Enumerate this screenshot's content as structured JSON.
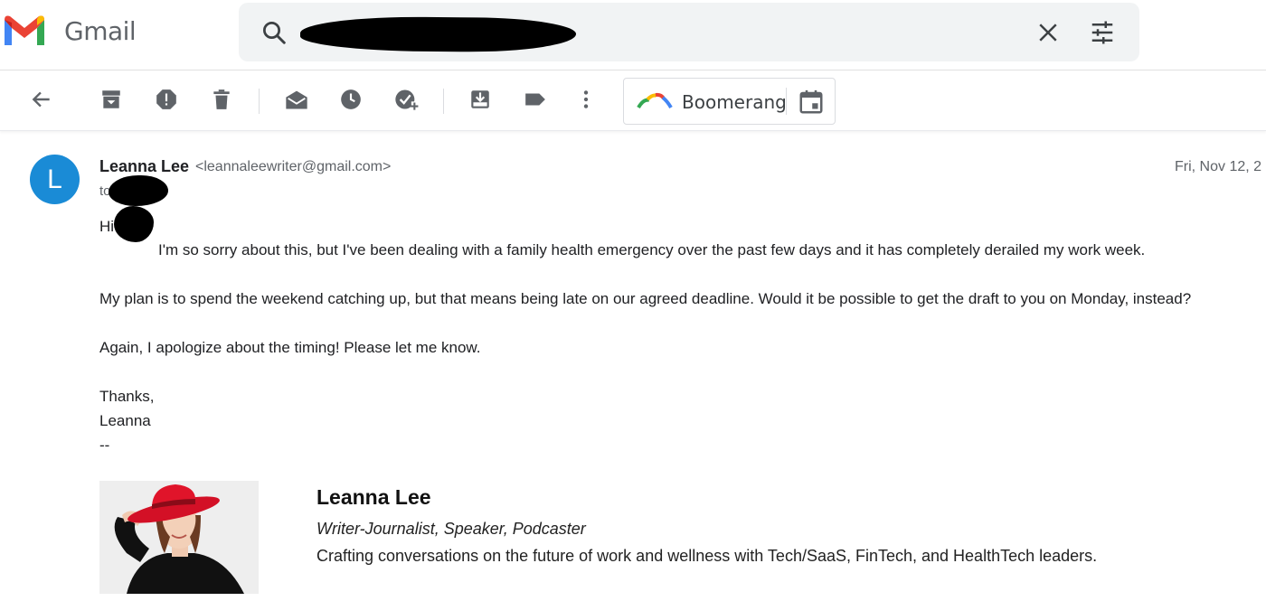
{
  "app": {
    "name": "Gmail"
  },
  "search": {
    "value": "",
    "placeholder": ""
  },
  "toolbar": {
    "icons": [
      "back-arrow-icon",
      "archive-icon",
      "report-spam-icon",
      "delete-icon",
      "mark-unread-icon",
      "snooze-icon",
      "add-task-icon",
      "move-to-icon",
      "label-icon",
      "more-vert-icon"
    ],
    "boomerang_label": "Boomerang"
  },
  "message": {
    "avatar_letter": "L",
    "sender_name": "Leanna Lee",
    "sender_email": "<leannaleewriter@gmail.com>",
    "date": "Fri, Nov 12, 2",
    "to_label": "to",
    "greeting": "Hi",
    "body": [
      "I'm so sorry about this, but I've been dealing with a family health emergency over the past few days and it has completely derailed my work week.",
      "My plan is to spend the weekend catching up, but that means being late on our agreed deadline. Would it be possible to get the draft to you on Monday, instead?",
      "Again, I apologize about the timing! Please let me know.",
      "Thanks,",
      "Leanna",
      "--"
    ]
  },
  "signature": {
    "name": "Leanna Lee",
    "title": "Writer-Journalist, Speaker, Podcaster",
    "tagline": "Crafting conversations on the future of work and wellness with Tech/SaaS, FinTech, and HealthTech leaders."
  },
  "colors": {
    "avatar": "#1a8bd6",
    "search_bg": "#f1f3f4",
    "icon_gray": "#5f6368",
    "hat_red": "#e0142a"
  }
}
